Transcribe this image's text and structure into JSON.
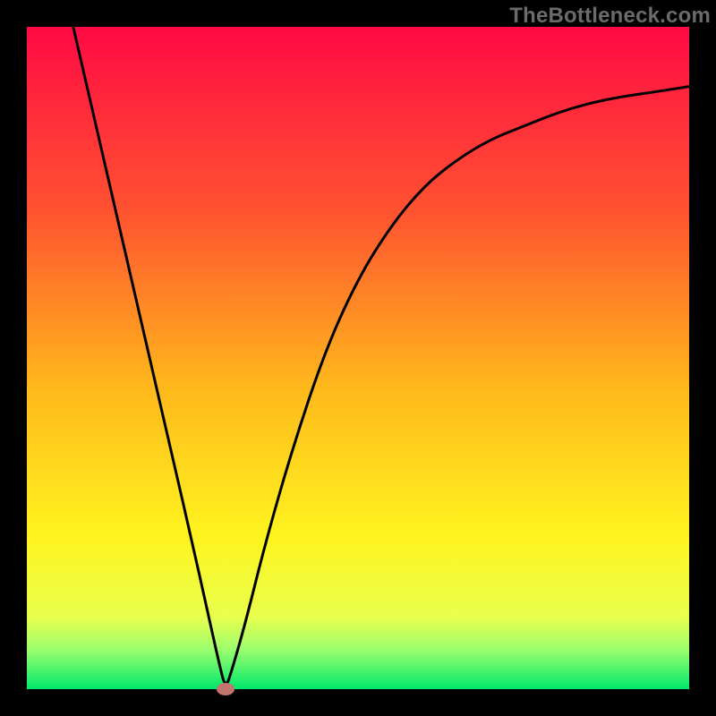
{
  "watermark": "TheBottleneck.com",
  "chart_data": {
    "type": "line",
    "title": "",
    "xlabel": "",
    "ylabel": "",
    "xlim": [
      0,
      100
    ],
    "ylim": [
      0,
      100
    ],
    "grid": false,
    "legend": false,
    "min_point": {
      "x": 30,
      "y": 0
    },
    "series": [
      {
        "name": "curve",
        "x": [
          7,
          10,
          13,
          16,
          19,
          22,
          25,
          27,
          29,
          30,
          31,
          33,
          36,
          40,
          45,
          50,
          55,
          60,
          65,
          70,
          75,
          80,
          85,
          90,
          95,
          100
        ],
        "y": [
          100,
          87,
          74,
          61,
          48,
          35,
          22,
          13,
          4,
          0,
          3,
          10,
          22,
          36,
          51,
          62,
          70,
          76,
          80,
          83,
          85,
          87,
          88.5,
          89.5,
          90.2,
          91
        ]
      }
    ],
    "gradient_stops": [
      {
        "offset": 0,
        "color": "#ff0a44"
      },
      {
        "offset": 28,
        "color": "#ff5330"
      },
      {
        "offset": 55,
        "color": "#ffba1c"
      },
      {
        "offset": 77,
        "color": "#fff41f"
      },
      {
        "offset": 89,
        "color": "#e9ff4d"
      },
      {
        "offset": 94,
        "color": "#9cff6e"
      },
      {
        "offset": 100,
        "color": "#00e86b"
      }
    ],
    "marker": {
      "x": 30,
      "y": 0,
      "color": "#c4746e"
    }
  }
}
